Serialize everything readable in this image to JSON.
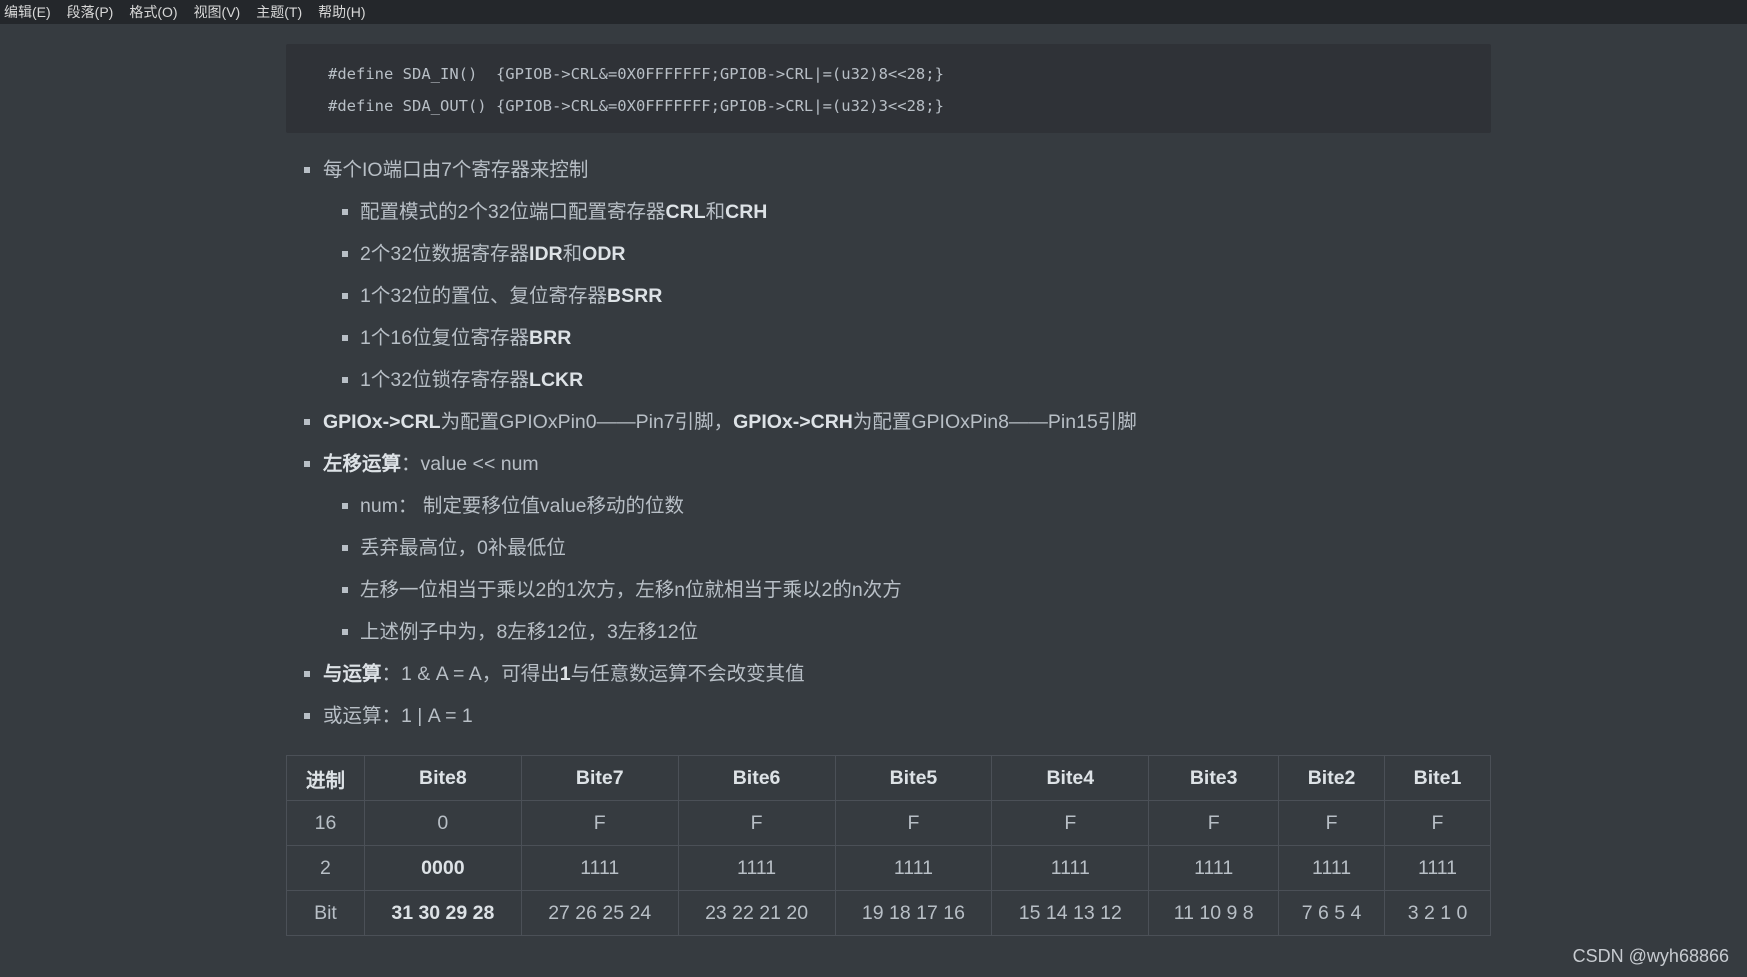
{
  "menu": [
    "编辑(E)",
    "段落(P)",
    "格式(O)",
    "视图(V)",
    "主题(T)",
    "帮助(H)"
  ],
  "code": [
    "#define SDA_IN()  {GPIOB->CRL&=0X0FFFFFFF;GPIOB->CRL|=(u32)8<<28;}",
    "#define SDA_OUT() {GPIOB->CRL&=0X0FFFFFFF;GPIOB->CRL|=(u32)3<<28;}"
  ],
  "list": {
    "i1": "每个IO端口由7个寄存器来控制",
    "s1a": "配置模式的2个32位端口配置寄存器",
    "s1b": "CRL",
    "s1c": "和",
    "s1d": "CRH",
    "s2a": "2个32位数据寄存器",
    "s2b": "IDR",
    "s2c": "和",
    "s2d": "ODR",
    "s3a": "1个32位的置位、复位寄存器",
    "s3b": "BSRR",
    "s4a": "1个16位复位寄存器",
    "s4b": "BRR",
    "s5a": "1个32位锁存寄存器",
    "s5b": "LCKR",
    "i2a": "GPIOx->CRL",
    "i2b": "为配置GPIOxPin0——Pin7引脚，",
    "i2c": "GPIOx->CRH",
    "i2d": "为配置GPIOxPin8——Pin15引脚",
    "i3a": "左移运算",
    "i3b": "：value << num",
    "s6": "num： 制定要移位值value移动的位数",
    "s7": "丢弃最高位，0补最低位",
    "s8": "左移一位相当于乘以2的1次方，左移n位就相当于乘以2的n次方",
    "s9": "上述例子中为，8左移12位，3左移12位",
    "i4a": "与运算",
    "i4b": "：1 & A = A，可得出",
    "i4c": "1",
    "i4d": "与任意数运算不会改变其值",
    "i5": "或运算：1 | A = 1"
  },
  "table": {
    "headers": [
      "进制",
      "Bite8",
      "Bite7",
      "Bite6",
      "Bite5",
      "Bite4",
      "Bite3",
      "Bite2",
      "Bite1"
    ],
    "rows": [
      [
        "16",
        "0",
        "F",
        "F",
        "F",
        "F",
        "F",
        "F",
        "F"
      ],
      [
        "2",
        "0000",
        "1111",
        "1111",
        "1111",
        "1111",
        "1111",
        "1111",
        "1111"
      ],
      [
        "Bit",
        "31 30 29 28",
        "27 26 25 24",
        "23 22 21 20",
        "19 18 17 16",
        "15 14 13 12",
        "11 10 9 8",
        "7 6 5 4",
        "3 2 1 0"
      ]
    ]
  },
  "watermark": "CSDN @wyh68866"
}
